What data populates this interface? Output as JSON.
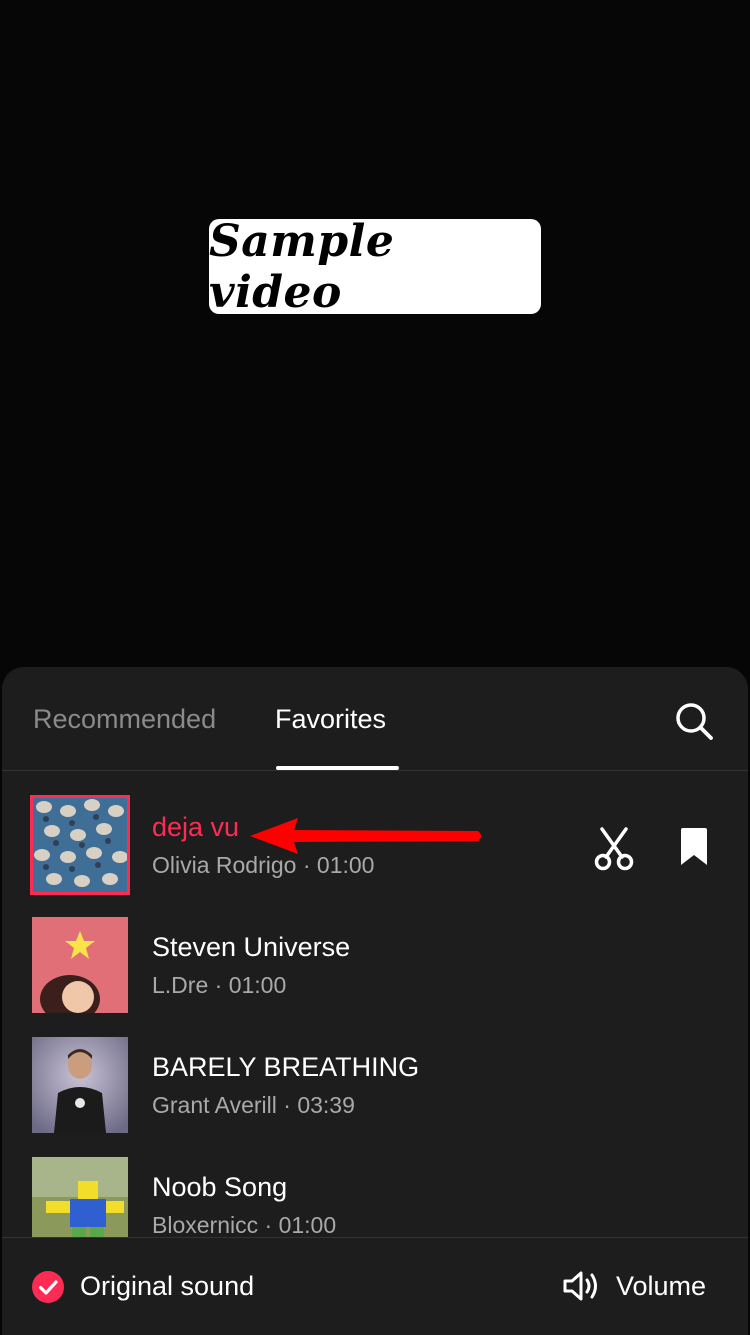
{
  "video": {
    "label": "Sample video"
  },
  "tabs": [
    {
      "label": "Recommended",
      "active": false
    },
    {
      "label": "Favorites",
      "active": true
    }
  ],
  "songs": [
    {
      "title": "deja vu",
      "artist": "Olivia Rodrigo",
      "duration": "01:00",
      "selected": true
    },
    {
      "title": "Steven Universe",
      "artist": "L.Dre",
      "duration": "01:00",
      "selected": false
    },
    {
      "title": "BARELY BREATHING",
      "artist": "Grant Averill",
      "duration": "03:39",
      "selected": false
    },
    {
      "title": "Noob Song",
      "artist": "Bloxernicc",
      "duration": "01:00",
      "selected": false
    }
  ],
  "bottom": {
    "original_sound": "Original sound",
    "volume": "Volume"
  },
  "colors": {
    "accent": "#fe2c55",
    "sheet_bg": "#1d1d1d",
    "muted_text": "#a9a9a9",
    "annotation_arrow": "#ff0000"
  },
  "icons": [
    "search-icon",
    "scissors-icon",
    "bookmark-icon",
    "check-circle-icon",
    "volume-icon"
  ]
}
